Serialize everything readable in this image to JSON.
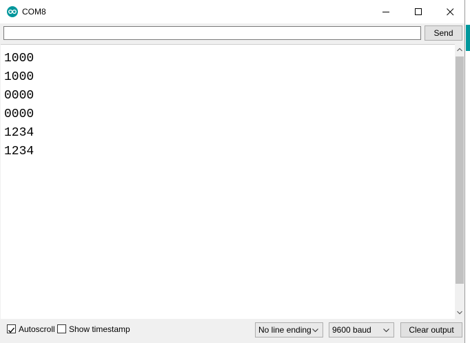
{
  "window": {
    "title": "COM8",
    "minimize_icon": "minimize-icon",
    "maximize_icon": "maximize-icon",
    "close_icon": "close-icon",
    "app_icon": "arduino-icon"
  },
  "send_bar": {
    "input_value": "",
    "send_label": "Send"
  },
  "output": {
    "lines": [
      "1000",
      "1000",
      "0000",
      "0000",
      "1234",
      "1234"
    ]
  },
  "footer": {
    "autoscroll_label": "Autoscroll",
    "autoscroll_checked": true,
    "timestamp_label": "Show timestamp",
    "timestamp_checked": false,
    "line_ending": "No line ending",
    "baud": "9600 baud",
    "clear_label": "Clear output"
  },
  "colors": {
    "accent": "#00979c"
  }
}
